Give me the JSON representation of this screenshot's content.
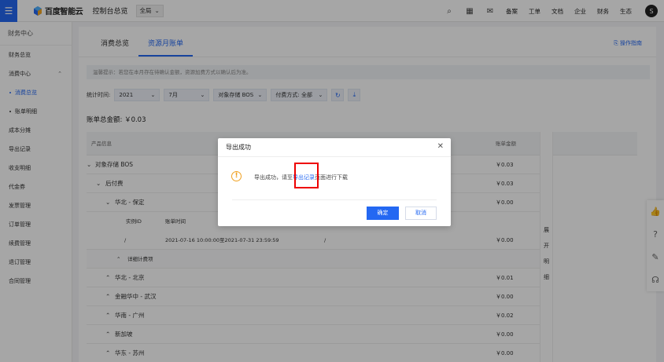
{
  "topbar": {
    "logo_text": "百度智能云",
    "console_title": "控制台总览",
    "region": "全局",
    "links": [
      "备案",
      "工单",
      "文档",
      "企业",
      "财务",
      "生态"
    ],
    "avatar_letter": "S"
  },
  "sidebar": {
    "heading": "财务中心",
    "items": [
      {
        "label": "财务总览"
      },
      {
        "label": "消费中心"
      },
      {
        "label": "消费总览"
      },
      {
        "label": "账单明细"
      },
      {
        "label": "成本分摊"
      },
      {
        "label": "导出记录"
      },
      {
        "label": "收支明细"
      },
      {
        "label": "代金券"
      },
      {
        "label": "发票管理"
      },
      {
        "label": "订单管理"
      },
      {
        "label": "续费管理"
      },
      {
        "label": "退订管理"
      },
      {
        "label": "合同管理"
      }
    ]
  },
  "tabs": [
    {
      "label": "消费总览"
    },
    {
      "label": "资源月账单"
    }
  ],
  "guide_link": "操作指南",
  "notice": "温馨提示：若您在本月存在待确认金额，资源加费方式以确认后为准。",
  "filters": {
    "label": "统计时间:",
    "year": "2021",
    "month": "7月",
    "product": "对象存储 BOS",
    "pay_type": "付费方式: 全部"
  },
  "total": "账单总金额: ￥0.03",
  "table": {
    "col_product": "产品信息",
    "col_amount": "账单金额",
    "rows": {
      "bos": {
        "label": "对象存储 BOS",
        "amount": "￥0.03"
      },
      "postpaid": {
        "label": "后付费",
        "amount": "￥0.03"
      },
      "baoding": {
        "label": "华北 - 保定",
        "amount": "￥0.00"
      },
      "instance_header": {
        "id_label": "实例ID",
        "time_label": "账单时间"
      },
      "instance": {
        "id": "/",
        "time": "2021-07-16 10:00:00至2021-07-31 23:59:59",
        "extra": "/",
        "amount": "￥0.00"
      },
      "detail_fee": {
        "label": "详细计费项"
      },
      "beijing": {
        "label": "华北 - 北京",
        "amount": "￥0.01"
      },
      "wuhan": {
        "label": "金融华中 - 武汉",
        "amount": "￥0.00"
      },
      "guangzhou": {
        "label": "华南 - 广州",
        "amount": "￥0.02"
      },
      "singapore": {
        "label": "新加坡",
        "amount": "￥0.00"
      },
      "suzhou": {
        "label": "华东 - 苏州",
        "amount": "￥0.00"
      }
    },
    "expand_label": [
      "展",
      "开",
      "明",
      "细"
    ]
  },
  "dialog": {
    "title": "导出成功",
    "message_before": "导出成功，请至",
    "message_link": "导出记录",
    "message_after": "页面进行下载",
    "confirm_label": "确定",
    "cancel_label": "取消"
  },
  "colors": {
    "accent": "#2468f2",
    "warning": "#f0a020",
    "highlight": "#e00000"
  }
}
